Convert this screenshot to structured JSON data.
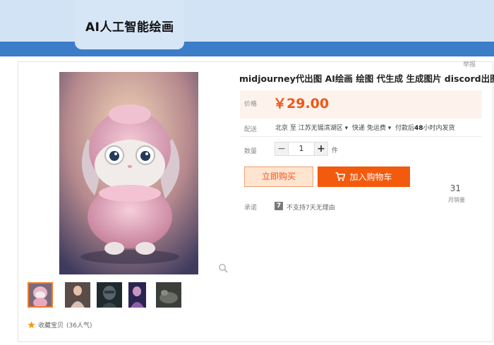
{
  "header": {
    "title": "AI人工智能绘画"
  },
  "report_link": "举报",
  "product": {
    "title": "midjourney代出图 AI绘画 绘图 代生成 生成图片 discord出图",
    "price_label": "价格",
    "price": "￥29.00",
    "sales_count": "31",
    "sales_label": "月销量",
    "delivery_label": "配送",
    "origin": "北京",
    "to_word": "至",
    "destination": "江苏无锡滨湖区",
    "express": "快递",
    "free_shipping": "免运费",
    "ship_note_pre": "付款后",
    "ship_note_bold": "48",
    "ship_note_post": "小时内发货",
    "quantity_label": "数量",
    "quantity": "1",
    "minus": "−",
    "plus": "+",
    "unit": "件",
    "buy_now": "立即购买",
    "add_to_cart": "加入购物车",
    "promise_label": "承诺",
    "promise_icon": "7",
    "promise_text": "不支持7天无理由"
  },
  "favorites": {
    "label": "收藏宝贝",
    "count": "(36人气)"
  },
  "colors": {
    "accent": "#f35a0d",
    "header_blue": "#3b7dc8",
    "price": "#f1551a"
  },
  "icons": {
    "zoom": "magnifier-icon",
    "cart": "cart-icon",
    "star": "star-icon",
    "dropdown": "caret-down-icon"
  }
}
